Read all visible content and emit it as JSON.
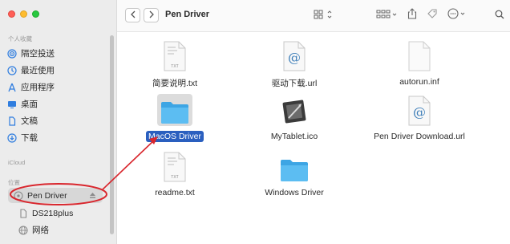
{
  "window": {
    "title": "Pen Driver"
  },
  "sidebar": {
    "favorites_title": "个人收藏",
    "favorites": [
      {
        "label": "隔空投送",
        "icon": "airdrop-icon"
      },
      {
        "label": "最近使用",
        "icon": "clock-icon"
      },
      {
        "label": "应用程序",
        "icon": "applications-icon"
      },
      {
        "label": "桌面",
        "icon": "desktop-icon"
      },
      {
        "label": "文稿",
        "icon": "document-icon"
      },
      {
        "label": "下载",
        "icon": "download-icon"
      }
    ],
    "icloud_title": "iCloud",
    "locations_title": "位置",
    "locations": [
      {
        "label": "Pen Driver",
        "icon": "drive-icon",
        "selected": true
      },
      {
        "label": "DS218plus",
        "icon": "server-icon"
      },
      {
        "label": "网络",
        "icon": "network-icon"
      }
    ]
  },
  "files": [
    {
      "name": "简要说明.txt",
      "type": "txt"
    },
    {
      "name": "驱动下载.url",
      "type": "url"
    },
    {
      "name": "autorun.inf",
      "type": "blank"
    },
    {
      "name": "MacOS Driver",
      "type": "folder",
      "selected": true
    },
    {
      "name": "MyTablet.ico",
      "type": "ico"
    },
    {
      "name": "Pen Driver Download.url",
      "type": "url"
    },
    {
      "name": "readme.txt",
      "type": "txt"
    },
    {
      "name": "Windows Driver",
      "type": "folder"
    }
  ],
  "colors": {
    "accent": "#2a5fbf",
    "annotation": "#d9272e",
    "folder": "#4fb3ec"
  }
}
